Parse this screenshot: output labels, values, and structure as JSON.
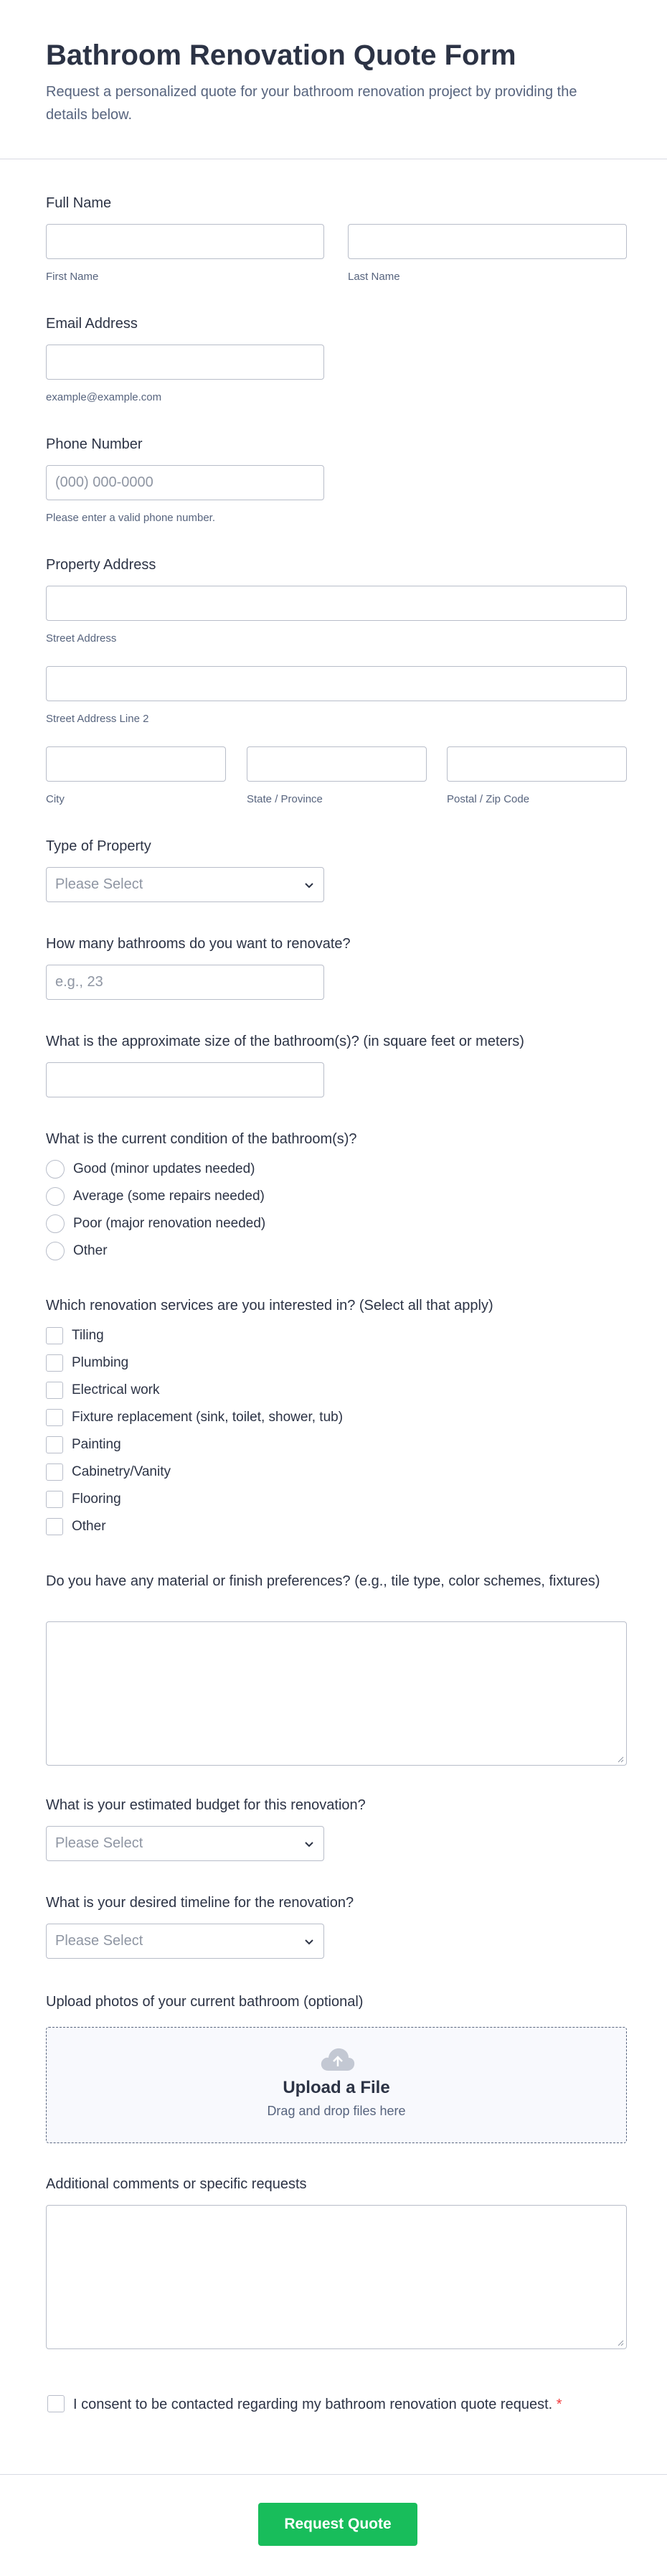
{
  "form": {
    "title": "Bathroom Renovation Quote Form",
    "subtitle": "Request a personalized quote for your bathroom renovation project by providing the details below."
  },
  "full_name": {
    "label": "Full Name",
    "first_sublabel": "First Name",
    "last_sublabel": "Last Name",
    "first_value": "",
    "last_value": ""
  },
  "email": {
    "label": "Email Address",
    "sublabel": "example@example.com",
    "value": ""
  },
  "phone": {
    "label": "Phone Number",
    "placeholder": "(000) 000-0000",
    "sublabel": "Please enter a valid phone number."
  },
  "address": {
    "label": "Property Address",
    "street_sublabel": "Street Address",
    "street2_sublabel": "Street Address Line 2",
    "city_sublabel": "City",
    "state_sublabel": "State / Province",
    "zip_sublabel": "Postal / Zip Code"
  },
  "property_type": {
    "label": "Type of Property",
    "selected": "Please Select"
  },
  "bathrooms": {
    "label": "How many bathrooms do you want to renovate?",
    "placeholder": "e.g., 23"
  },
  "size": {
    "label": "What is the approximate size of the bathroom(s)? (in square feet or meters)"
  },
  "condition": {
    "label": "What is the current condition of the bathroom(s)?",
    "options": [
      "Good (minor updates needed)",
      "Average (some repairs needed)",
      "Poor (major renovation needed)",
      "Other"
    ]
  },
  "services": {
    "label": "Which renovation services are you interested in? (Select all that apply)",
    "options": [
      "Tiling",
      "Plumbing",
      "Electrical work",
      "Fixture replacement (sink, toilet, shower, tub)",
      "Painting",
      "Cabinetry/Vanity",
      "Flooring",
      "Other"
    ]
  },
  "materials": {
    "label": "Do you have any material or finish preferences? (e.g., tile type, color schemes, fixtures)"
  },
  "budget": {
    "label": "What is your estimated budget for this renovation?",
    "selected": "Please Select"
  },
  "timeline": {
    "label": "What is your desired timeline for the renovation?",
    "selected": "Please Select"
  },
  "upload": {
    "label": "Upload photos of your current bathroom (optional)",
    "title": "Upload a File",
    "subtitle": "Drag and drop files here"
  },
  "comments": {
    "label": "Additional comments or specific requests"
  },
  "consent": {
    "label": "I consent to be contacted regarding my bathroom renovation quote request.",
    "required_mark": "*"
  },
  "submit": {
    "label": "Request Quote"
  },
  "colors": {
    "submit_bg": "#18bd5b",
    "text": "#2c3345",
    "muted": "#57647e",
    "border": "#b8bdc9",
    "required": "#f23a3c"
  },
  "icons": {
    "select_arrow": "chevron-down-icon",
    "upload": "cloud-upload-icon",
    "textarea_resize": "resize-grip-icon"
  }
}
